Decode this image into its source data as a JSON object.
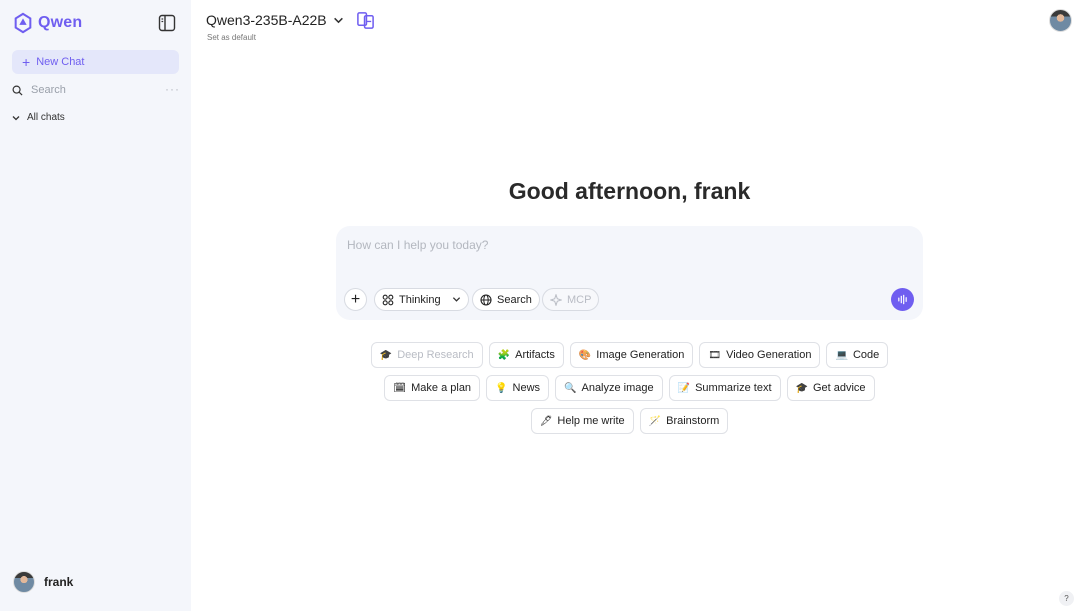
{
  "app": {
    "name": "Qwen",
    "accent": "#6f5ef0"
  },
  "sidebar": {
    "new_chat_label": "New Chat",
    "search_placeholder": "Search",
    "more_label": "···",
    "all_chats_label": "All chats",
    "user_name": "frank"
  },
  "header": {
    "model_name": "Qwen3-235B-A22B",
    "set_default_label": "Set as default"
  },
  "main": {
    "greeting": "Good afternoon, frank",
    "input_placeholder": "How can I help you today?",
    "tools": {
      "add": "+",
      "thinking": "Thinking",
      "search": "Search",
      "mcp": "MCP"
    },
    "chips": [
      [
        {
          "emoji": "🎓",
          "label": "Deep Research"
        },
        {
          "emoji": "🧩",
          "label": "Artifacts"
        },
        {
          "emoji": "🎨",
          "label": "Image Generation"
        },
        {
          "emoji": "🎞",
          "label": "Video Generation"
        },
        {
          "emoji": "💻",
          "label": "Code"
        }
      ],
      [
        {
          "emoji": "🗓",
          "label": "Make a plan"
        },
        {
          "emoji": "💡",
          "label": "News"
        },
        {
          "emoji": "🔍",
          "label": "Analyze image"
        },
        {
          "emoji": "📝",
          "label": "Summarize text"
        },
        {
          "emoji": "🎓",
          "label": "Get advice"
        }
      ],
      [
        {
          "emoji": "🖋",
          "label": "Help me write"
        },
        {
          "emoji": "🪄",
          "label": "Brainstorm"
        }
      ]
    ]
  },
  "help_label": "?"
}
